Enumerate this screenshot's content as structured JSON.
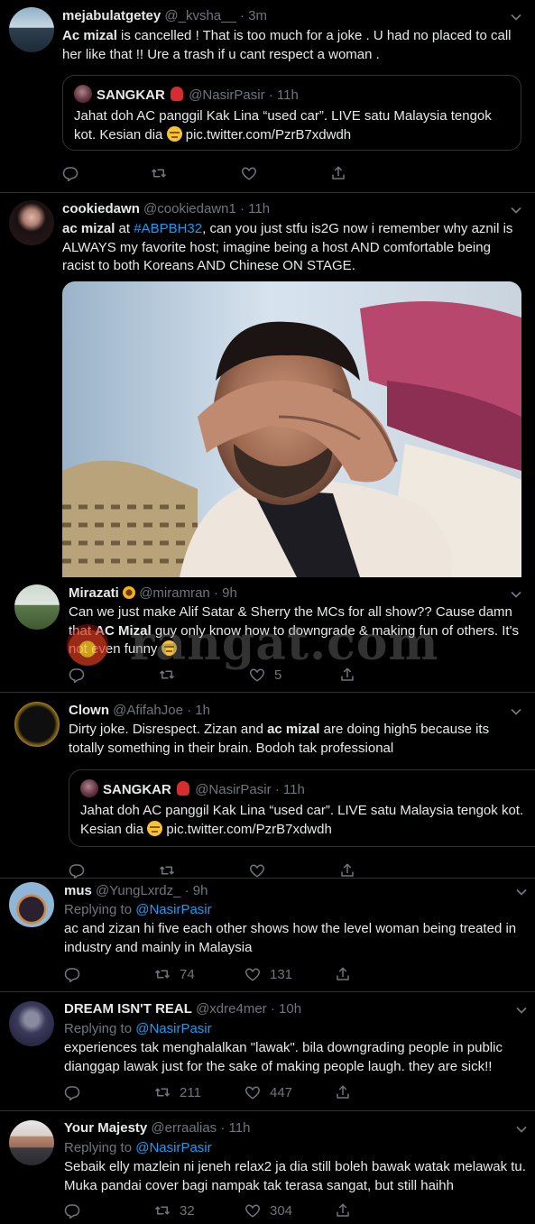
{
  "tweets": [
    {
      "name": "mejabulatgetey",
      "handle": "@_kvsha__",
      "time": "· 3m",
      "text_bold": "Ac mizal",
      "text": " is cancelled ! That is too much for a joke . U had no placed to call her like that !! Ure a trash if u cant respect a woman .",
      "quote": {
        "name": "SANGKAR",
        "handle": "@NasirPasir",
        "time": "· 11h",
        "text": "Jahat doh AC panggil Kak Lina “used car”. LIVE satu Malaysia tengok kot. Kesian dia",
        "link": "pic.twitter.com/PzrB7xdwdh"
      }
    },
    {
      "name": "cookiedawn",
      "handle": "@cookiedawn1",
      "time": "· 11h",
      "text_bold": "ac mizal",
      "text_a": " at ",
      "hashtag": "#ABPBH32",
      "text_b": ", can you just stfu is2G now i remember why aznil is ALWAYS my favorite host; imagine being a host AND comfortable being racist to both Koreans AND Chinese ON STAGE."
    },
    {
      "name": "Mirazati",
      "handle": "@miramran",
      "time": "· 9h",
      "text_a": "Can we just make Alif Satar & Sherry the MCs for all show?? Cause damn that ",
      "text_bold": "AC Mizal",
      "text_b": " guy only know how to downgrade & making fun of others. It's not even funny",
      "likes": "5",
      "watermark": "rangat.com"
    },
    {
      "name": "Clown",
      "handle": "@AfifahJoe",
      "time": "· 1h",
      "text_a": "Dirty joke. Disrespect. Zizan and ",
      "text_bold": "ac mizal",
      "text_b": " are doing high5 because its totally something in their brain. Bodoh tak professional",
      "quote": {
        "name": "SANGKAR",
        "handle": "@NasirPasir",
        "time": "· 11h",
        "text": "Jahat doh AC panggil Kak Lina “used car”. LIVE satu Malaysia tengok kot. Kesian dia",
        "link": "pic.twitter.com/PzrB7xdwdh"
      }
    },
    {
      "name": "mus",
      "handle": "@YungLxrdz_",
      "time": "· 9h",
      "replying": "Replying to",
      "reply_to": "@NasirPasir",
      "text": "ac and zizan hi five each other shows how the level woman being treated in industry and mainly in Malaysia",
      "retweets": "74",
      "likes": "131"
    },
    {
      "name": "DREAM ISN'T REAL",
      "handle": "@xdre4mer",
      "time": "· 10h",
      "replying": "Replying to",
      "reply_to": "@NasirPasir",
      "text": "experiences tak menghalalkan \"lawak\". bila downgrading people in public dianggap lawak just for the sake of making people laugh. they are sick!!",
      "retweets": "211",
      "likes": "447"
    },
    {
      "name": "Your Majesty",
      "handle": "@erraalias",
      "time": "· 11h",
      "replying": "Replying to",
      "reply_to": "@NasirPasir",
      "text": "Sebaik elly mazlein ni jeneh relax2 ja dia still boleh bawak watak melawak tu. Muka pandai cover bagi nampak tak terasa sangat, but still haihh",
      "retweets": "32",
      "likes": "304"
    }
  ],
  "colors": {
    "background": "#000000",
    "link": "#1d9bf0",
    "muted": "#6e767d",
    "text": "#e7e9ea",
    "border": "#2f3336"
  }
}
